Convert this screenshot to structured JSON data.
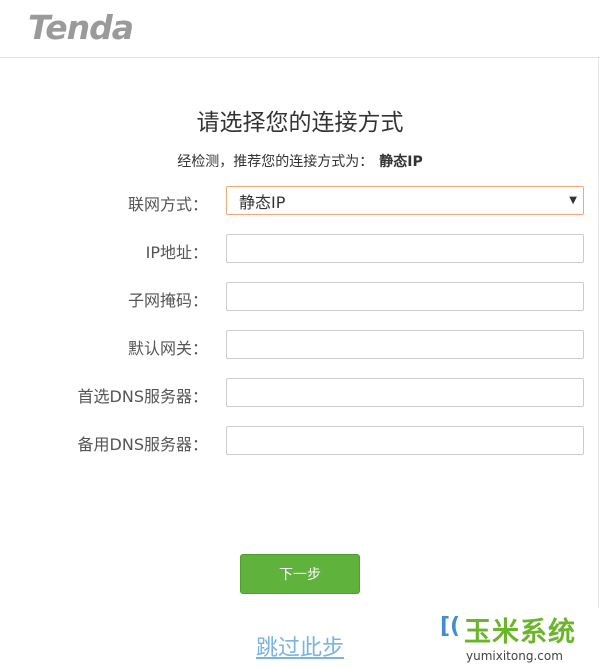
{
  "header": {
    "logo": "Tenda"
  },
  "page": {
    "title": "请选择您的连接方式",
    "hint_prefix": "经检测，推荐您的连接方式为：",
    "hint_value": "静态IP"
  },
  "form": {
    "connection_type": {
      "label": "联网方式：",
      "value": "静态IP"
    },
    "ip_address": {
      "label": "IP地址：",
      "value": "",
      "placeholder": ""
    },
    "subnet_mask": {
      "label": "子网掩码：",
      "value": "",
      "placeholder": ""
    },
    "default_gateway": {
      "label": "默认网关：",
      "value": "",
      "placeholder": ""
    },
    "primary_dns": {
      "label": "首选DNS服务器：",
      "value": "",
      "placeholder": ""
    },
    "secondary_dns": {
      "label": "备用DNS服务器：",
      "value": "",
      "placeholder": ""
    }
  },
  "actions": {
    "next_label": "下一步",
    "skip_label": "跳过此步"
  },
  "watermark": {
    "icon": "[(",
    "text": "玉米系统",
    "url": "yumixitong.com"
  },
  "colors": {
    "accent_green": "#5fb23c",
    "select_border": "#f0a874",
    "link_blue": "#7ab3e0",
    "logo_gray": "#9a9a9a"
  },
  "icons": {
    "select_caret": "caret-down-icon"
  }
}
